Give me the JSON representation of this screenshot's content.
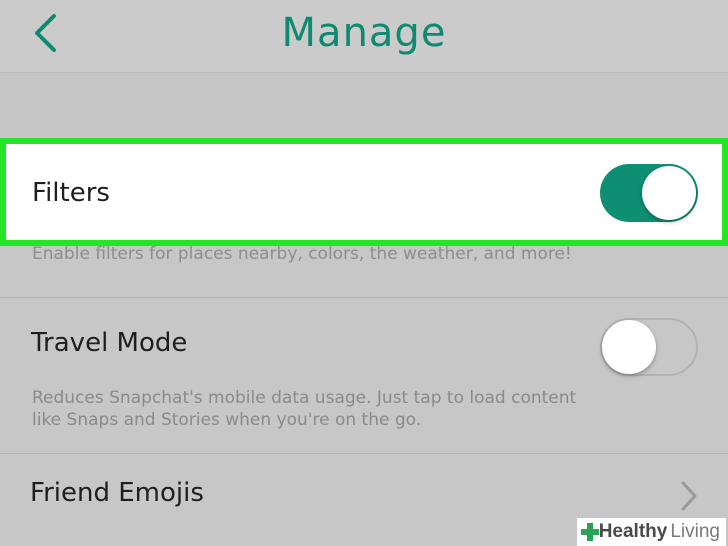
{
  "header": {
    "title": "Manage",
    "back_icon": "chevron-left-icon"
  },
  "filters": {
    "label": "Filters",
    "toggle_on": true,
    "description": "Enable filters for places nearby, colors, the weather, and more!"
  },
  "travel_mode": {
    "label": "Travel Mode",
    "toggle_on": false,
    "description_line1": "Reduces Snapchat's mobile data usage. Just tap to load content",
    "description_line2": "like Snaps and Stories when you're on the go."
  },
  "friend_emojis": {
    "label": "Friend Emojis",
    "chevron_icon": "chevron-right-icon"
  },
  "watermark": {
    "brand_bold": "Healthy",
    "brand_light": "Living"
  },
  "colors": {
    "accent": "#0e8a70",
    "highlight": "#26e526",
    "toggle_on": "#0e8f74"
  }
}
